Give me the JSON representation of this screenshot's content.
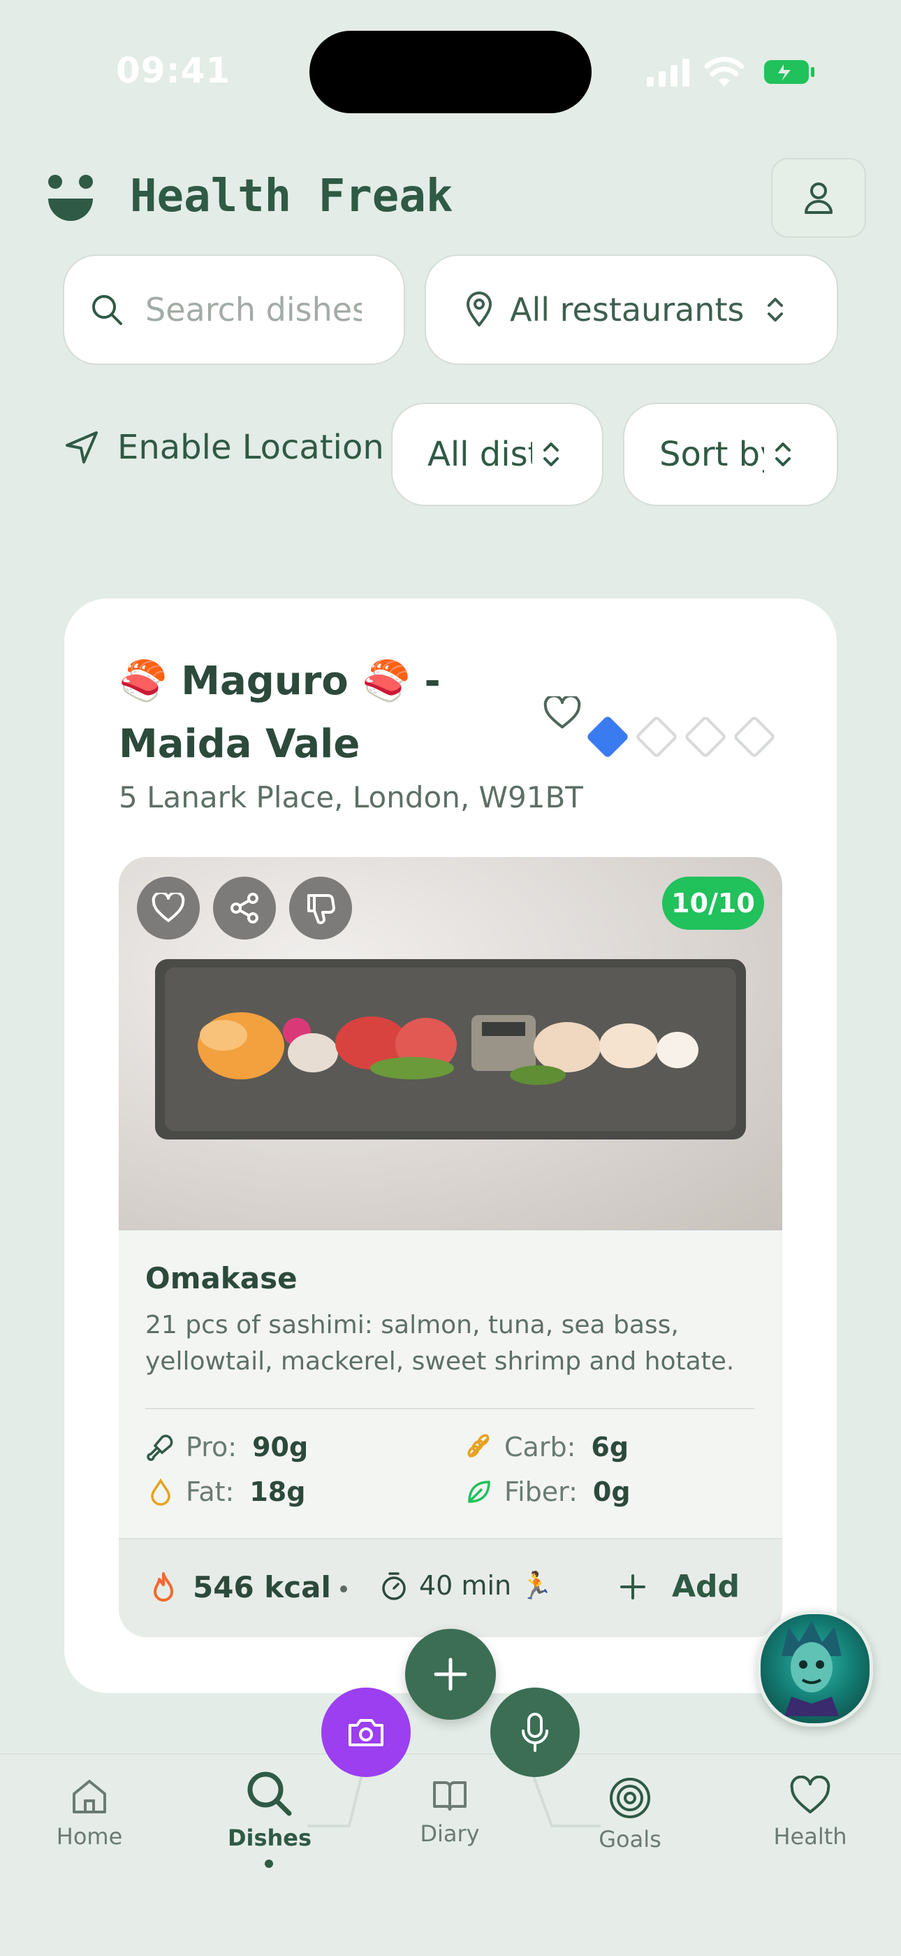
{
  "status_bar": {
    "time": "09:41"
  },
  "header": {
    "app_title": "Health Freak"
  },
  "filters": {
    "search_placeholder": "Search dishes",
    "restaurant_select": "All restaurants",
    "enable_location": "Enable Location",
    "distance_select": "All distances",
    "sort_select": "Sort by"
  },
  "card": {
    "restaurant_name": "🍣 Maguro 🍣 - Maida Vale",
    "address": "5 Lanark Place, London, W91BT",
    "rating_level": 1,
    "rating_max": 4,
    "score": "10/10",
    "dish_name": "Omakase",
    "dish_description": "21 pcs of sashimi: salmon, tuna, sea bass, yellowtail, mackerel, sweet shrimp and hotate.",
    "macros": {
      "protein_label": "Pro:",
      "protein_value": "90g",
      "carb_label": "Carb:",
      "carb_value": "6g",
      "fat_label": "Fat:",
      "fat_value": "18g",
      "fiber_label": "Fiber:",
      "fiber_value": "0g"
    },
    "kcal": "546 kcal",
    "time": "40 min 🏃",
    "add_label": "Add"
  },
  "nav": {
    "items": [
      {
        "label": "Home",
        "icon": "home-icon"
      },
      {
        "label": "Dishes",
        "icon": "search-icon"
      },
      {
        "label": "Diary",
        "icon": "book-icon"
      },
      {
        "label": "Goals",
        "icon": "target-icon"
      },
      {
        "label": "Health",
        "icon": "heart-icon"
      }
    ],
    "active": "Dishes"
  },
  "colors": {
    "background": "#e3ece6",
    "primary": "#2f5a45",
    "score_green": "#21c15c",
    "camera_purple": "#9b3ff0",
    "rating_blue": "#3b7bf0"
  }
}
